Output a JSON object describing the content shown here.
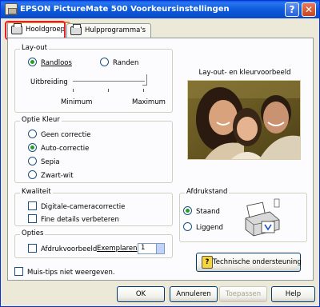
{
  "window": {
    "title": "EPSON PictureMate 500 Voorkeursinstellingen",
    "help_glyph": "?",
    "close_glyph": "✕"
  },
  "tabs": [
    {
      "label": "Hooldgroep",
      "active": true
    },
    {
      "label": "Hulpprogramma's",
      "active": false
    }
  ],
  "layout": {
    "legend": "Lay-out",
    "randloos": "Randloos",
    "randen": "Randen",
    "uitbreiding": "Uitbreiding",
    "minimum": "Minimum",
    "maximum": "Maximum",
    "selected": "Randloos"
  },
  "preview": {
    "label": "Lay-out- en kleurvoorbeeld"
  },
  "optie_kleur": {
    "legend": "Optie Kleur",
    "options": [
      "Geen correctie",
      "Auto-correctie",
      "Sepia",
      "Zwart-wit"
    ],
    "selected": "Auto-correctie"
  },
  "kwaliteit": {
    "legend": "Kwaliteit",
    "digitale": "Digitale-cameracorrectie",
    "fine": "Fine details verbeteren"
  },
  "afdrukstand": {
    "legend": "Afdrukstand",
    "staand": "Staand",
    "liggend": "Liggend",
    "selected": "Staand"
  },
  "opties": {
    "legend": "Opties",
    "afdrukvoorbeeld": "Afdrukvoorbeeld",
    "exemplaren_label": "Exemplaren",
    "exemplaren_value": "1"
  },
  "technische": "Technische ondersteuning",
  "muis_tips": "Muis-tips niet weergeven.",
  "buttons": {
    "ok": "OK",
    "annuleren": "Annuleren",
    "toepassen": "Toepassen",
    "help": "Help"
  }
}
